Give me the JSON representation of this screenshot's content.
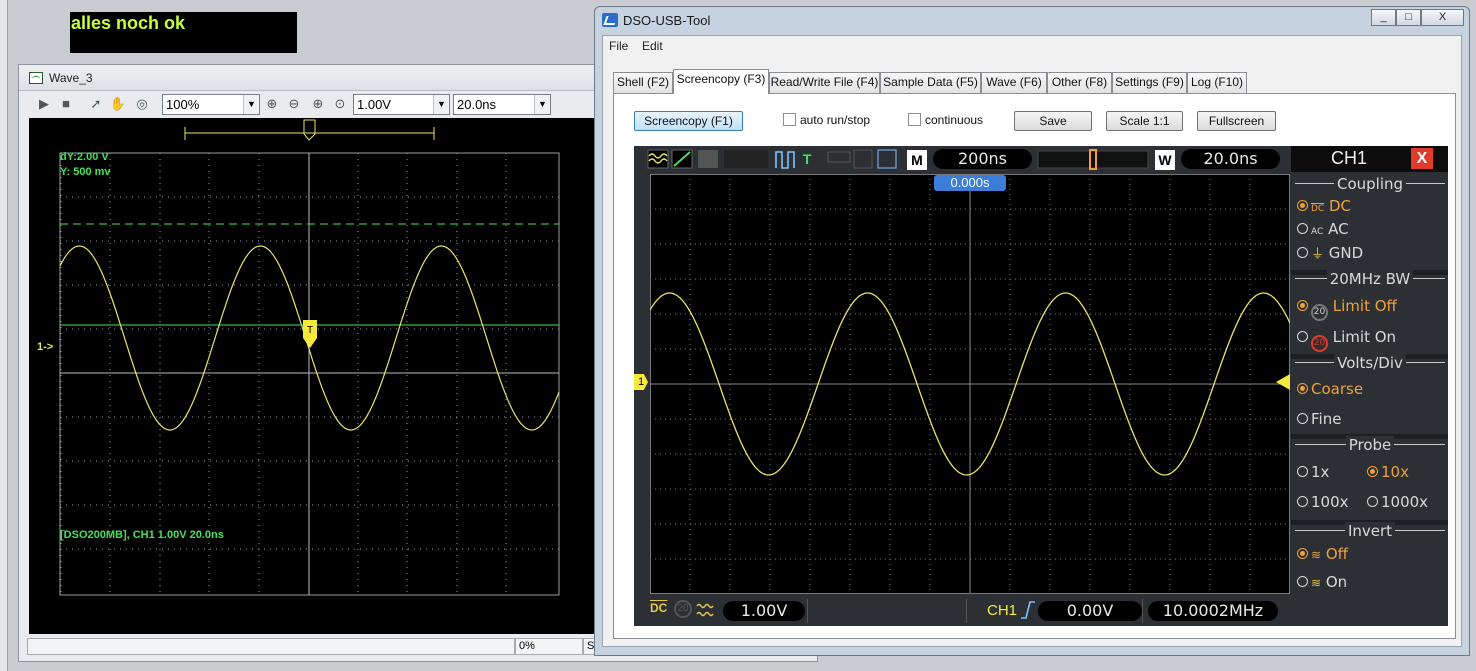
{
  "banner": {
    "text": "alles noch ok"
  },
  "wave_window": {
    "title": "Wave_3",
    "zoom": "100%",
    "volts": "1.00V",
    "time": "20.0ns",
    "cursor_dy": "dY:2.00 V",
    "cursor_y": "Y:  500 mv",
    "channel_marker": "1->",
    "footer_info": "[DSO200MB], CH1 1.00V 20.0ns",
    "status_percent": "0%",
    "status_right": "S"
  },
  "dso_window": {
    "title": "DSO-USB-Tool",
    "controls": {
      "minimize": "_",
      "maximize": "□",
      "close": "X"
    },
    "menu": [
      "File",
      "Edit"
    ],
    "tabs": [
      "Shell (F2)",
      "Screencopy (F3)",
      "Read/Write File (F4)",
      "Sample Data (F5)",
      "Wave (F6)",
      "Other (F8)",
      "Settings (F9)",
      "Log (F10)"
    ],
    "active_tab": "Screencopy (F3)",
    "actions": {
      "screencopy": "Screencopy (F1)",
      "auto_run": "auto run/stop",
      "continuous": "continuous",
      "save": "Save",
      "scale": "Scale 1:1",
      "fullscreen": "Fullscreen"
    },
    "scope": {
      "m_label": "M",
      "timebase": "200ns",
      "w_label": "W",
      "window": "20.0ns",
      "trigger_pos": "0.000s",
      "channel_marker": "1",
      "volts_div": "1.00V",
      "trig_channel": "CH1",
      "trig_level": "0.00V",
      "frequency": "10.0002MHz",
      "icon_t": "T",
      "icon_dc": "DC",
      "icon_20": "20"
    },
    "side_panel": {
      "channel": "CH1",
      "close": "X",
      "coupling": {
        "title": "Coupling",
        "options": [
          "DC",
          "AC",
          "GND"
        ],
        "selected": "DC"
      },
      "bw": {
        "title": "20MHz BW",
        "options": [
          "Limit Off",
          "Limit On"
        ],
        "selected": "Limit Off"
      },
      "volts_div": {
        "title": "Volts/Div",
        "options": [
          "Coarse",
          "Fine"
        ],
        "selected": "Coarse"
      },
      "probe": {
        "title": "Probe",
        "options": [
          "1x",
          "10x",
          "100x",
          "1000x"
        ],
        "selected": "10x"
      },
      "invert": {
        "title": "Invert",
        "options": [
          "Off",
          "On"
        ],
        "selected": "Off"
      },
      "icon_dc": "DC",
      "icon_ac": "AC",
      "icon_20": "20"
    }
  },
  "colors": {
    "trace": "#e8e36a",
    "grid_green": "#48e05a",
    "accent_orange": "#f0a13a",
    "trigger_blue": "#3b7dd8"
  }
}
